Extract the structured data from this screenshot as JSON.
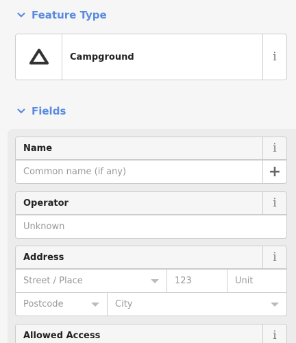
{
  "feature_type": {
    "heading": "Feature Type",
    "preset_name": "Campground",
    "info_glyph": "i",
    "icon": "campground-icon"
  },
  "fields": {
    "heading": "Fields",
    "name": {
      "label": "Name",
      "placeholder": "Common name (if any)",
      "info_glyph": "i",
      "add_glyph": "+"
    },
    "operator": {
      "label": "Operator",
      "placeholder": "Unknown",
      "info_glyph": "i"
    },
    "address": {
      "label": "Address",
      "info_glyph": "i",
      "street_placeholder": "Street / Place",
      "housenumber_placeholder": "123",
      "unit_placeholder": "Unit",
      "postcode_placeholder": "Postcode",
      "city_placeholder": "City"
    },
    "allowed_access": {
      "label": "Allowed Access",
      "info_glyph": "i"
    }
  },
  "colors": {
    "accent": "#5a8be0",
    "border": "#cccccc",
    "placeholder": "#999999",
    "panel": "#ececec"
  }
}
